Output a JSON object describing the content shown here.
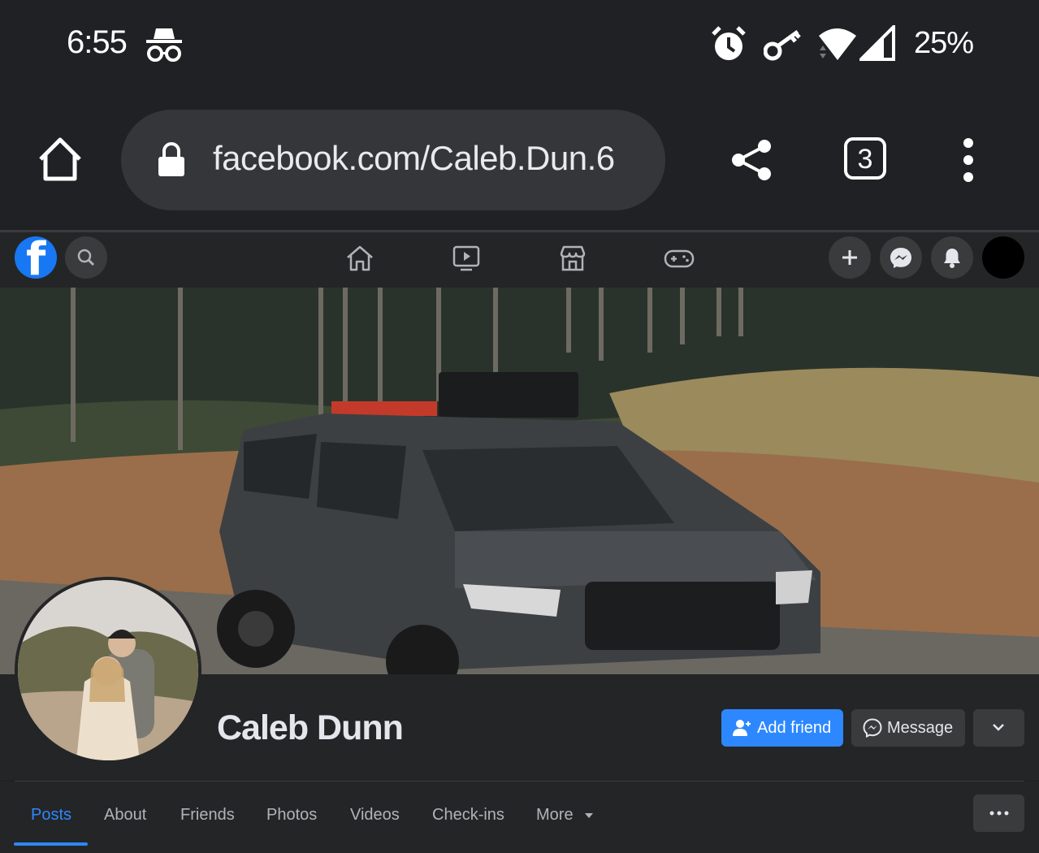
{
  "status_bar": {
    "time": "6:55",
    "battery": "25%",
    "icons": [
      "incognito-icon",
      "alarm-icon",
      "key-icon",
      "wifi-icon",
      "signal-icon"
    ]
  },
  "browser": {
    "url": "facebook.com/Caleb.Dun.6",
    "tab_count": "3",
    "icons": [
      "home-icon",
      "lock-icon",
      "share-icon",
      "tabs-icon",
      "more-vert-icon"
    ]
  },
  "fb_nav": {
    "icons": [
      "facebook-logo",
      "search-icon",
      "home-icon",
      "watch-icon",
      "marketplace-icon",
      "gaming-icon",
      "plus-icon",
      "messenger-icon",
      "bell-icon",
      "account-avatar"
    ]
  },
  "profile": {
    "name": "Caleb Dunn",
    "add_friend_label": "Add friend",
    "message_label": "Message"
  },
  "tabs": [
    {
      "label": "Posts",
      "active": true
    },
    {
      "label": "About"
    },
    {
      "label": "Friends"
    },
    {
      "label": "Photos"
    },
    {
      "label": "Videos"
    },
    {
      "label": "Check-ins"
    },
    {
      "label": "More"
    }
  ],
  "colors": {
    "accent": "#2d88ff",
    "facebook_blue": "#1877f2",
    "background": "#242526"
  }
}
